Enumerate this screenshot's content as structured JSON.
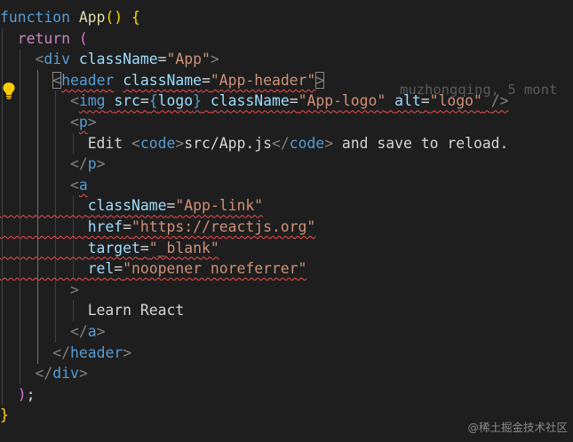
{
  "colors": {
    "background": "#1e1e1e",
    "keyword": "#569cd6",
    "control": "#c586c0",
    "function": "#dcdcaa",
    "paren_l1": "#ffd700",
    "paren_l2": "#da70d6",
    "tag": "#569cd6",
    "angle": "#808080",
    "attr": "#9cdcfe",
    "string": "#ce9178",
    "text": "#d4d4d4",
    "error": "#f14c4c",
    "lightbulb": "#ffcc00"
  },
  "lines": [
    [
      {
        "t": "function ",
        "c": "keyword"
      },
      {
        "t": "App",
        "c": "function"
      },
      {
        "t": "() {",
        "c": "paren_l1"
      }
    ],
    [
      {
        "t": "  "
      },
      {
        "t": "return",
        "c": "control"
      },
      {
        "t": " "
      },
      {
        "t": "(",
        "c": "paren_l2"
      }
    ],
    [
      {
        "t": "    "
      },
      {
        "t": "<",
        "c": "angle"
      },
      {
        "t": "div",
        "c": "tag"
      },
      {
        "t": " "
      },
      {
        "t": "className",
        "c": "attr"
      },
      {
        "t": "=",
        "c": "text"
      },
      {
        "t": "\"App\"",
        "c": "string"
      },
      {
        "t": ">",
        "c": "angle"
      }
    ],
    [
      {
        "t": "      "
      },
      {
        "t": "<",
        "c": "angle",
        "box": true
      },
      {
        "t": "header",
        "c": "tag",
        "sq": true
      },
      {
        "t": " "
      },
      {
        "t": "className",
        "c": "attr",
        "sq": true
      },
      {
        "t": "=",
        "c": "text",
        "sq": true
      },
      {
        "t": "\"App-header\"",
        "c": "string",
        "sq": true
      },
      {
        "t": ">",
        "c": "angle",
        "box": true
      }
    ],
    [
      {
        "t": "        "
      },
      {
        "t": "<",
        "c": "angle"
      },
      {
        "t": "img",
        "c": "tag",
        "sq": true
      },
      {
        "t": " ",
        "sq": true
      },
      {
        "t": "src",
        "c": "attr",
        "sq": true
      },
      {
        "t": "=",
        "c": "text",
        "sq": true
      },
      {
        "t": "{",
        "c": "keyword",
        "sq": true
      },
      {
        "t": "logo",
        "c": "attr",
        "sq": true
      },
      {
        "t": "}",
        "c": "keyword",
        "sq": true
      },
      {
        "t": " ",
        "sq": true
      },
      {
        "t": "className",
        "c": "attr",
        "sq": true
      },
      {
        "t": "=",
        "c": "text",
        "sq": true
      },
      {
        "t": "\"App-logo\"",
        "c": "string",
        "sq": true
      },
      {
        "t": " ",
        "sq": true
      },
      {
        "t": "alt",
        "c": "attr",
        "sq": true
      },
      {
        "t": "=",
        "c": "text",
        "sq": true
      },
      {
        "t": "\"logo\"",
        "c": "string",
        "sq": true
      },
      {
        "t": " ",
        "sq": true
      },
      {
        "t": "/>",
        "c": "angle",
        "sq": true
      }
    ],
    [
      {
        "t": "        "
      },
      {
        "t": "<",
        "c": "angle"
      },
      {
        "t": "p",
        "c": "tag",
        "sq": true
      },
      {
        "t": ">",
        "c": "angle"
      }
    ],
    [
      {
        "t": "          "
      },
      {
        "t": "Edit ",
        "c": "text"
      },
      {
        "t": "<",
        "c": "angle"
      },
      {
        "t": "code",
        "c": "tag"
      },
      {
        "t": ">",
        "c": "angle"
      },
      {
        "t": "src/App.js",
        "c": "text"
      },
      {
        "t": "</",
        "c": "angle"
      },
      {
        "t": "code",
        "c": "tag"
      },
      {
        "t": ">",
        "c": "angle"
      },
      {
        "t": " and save to reload.",
        "c": "text"
      }
    ],
    [
      {
        "t": "        "
      },
      {
        "t": "</",
        "c": "angle"
      },
      {
        "t": "p",
        "c": "tag"
      },
      {
        "t": ">",
        "c": "angle"
      }
    ],
    [
      {
        "t": "        "
      },
      {
        "t": "<",
        "c": "angle"
      },
      {
        "t": "a",
        "c": "tag",
        "sq": true
      }
    ],
    [
      {
        "t": "          ",
        "sq": true
      },
      {
        "t": "className",
        "c": "attr",
        "sq": true
      },
      {
        "t": "=",
        "c": "text",
        "sq": true
      },
      {
        "t": "\"App-link\"",
        "c": "string",
        "sq": true
      }
    ],
    [
      {
        "t": "          ",
        "sq": true
      },
      {
        "t": "href",
        "c": "attr",
        "sq": true
      },
      {
        "t": "=",
        "c": "text",
        "sq": true
      },
      {
        "t": "\"https://reactjs.org\"",
        "c": "string",
        "sq": true
      }
    ],
    [
      {
        "t": "          ",
        "sq": true
      },
      {
        "t": "target",
        "c": "attr",
        "sq": true
      },
      {
        "t": "=",
        "c": "text",
        "sq": true
      },
      {
        "t": "\"_blank\"",
        "c": "string",
        "sq": true
      }
    ],
    [
      {
        "t": "          ",
        "sq": true
      },
      {
        "t": "rel",
        "c": "attr",
        "sq": true
      },
      {
        "t": "=",
        "c": "text",
        "sq": true
      },
      {
        "t": "\"noopener noreferrer\"",
        "c": "string",
        "sq": true
      }
    ],
    [
      {
        "t": "        "
      },
      {
        "t": ">",
        "c": "angle"
      }
    ],
    [
      {
        "t": "          "
      },
      {
        "t": "Learn React",
        "c": "text"
      }
    ],
    [
      {
        "t": "        "
      },
      {
        "t": "</",
        "c": "angle"
      },
      {
        "t": "a",
        "c": "tag"
      },
      {
        "t": ">",
        "c": "angle"
      }
    ],
    [
      {
        "t": "      "
      },
      {
        "t": "</",
        "c": "angle"
      },
      {
        "t": "header",
        "c": "tag"
      },
      {
        "t": ">",
        "c": "angle"
      }
    ],
    [
      {
        "t": "    "
      },
      {
        "t": "</",
        "c": "angle"
      },
      {
        "t": "div",
        "c": "tag"
      },
      {
        "t": ">",
        "c": "angle"
      }
    ],
    [
      {
        "t": "  "
      },
      {
        "t": ")",
        "c": "paren_l2"
      },
      {
        "t": ";",
        "c": "text"
      }
    ],
    [
      {
        "t": "}",
        "c": "paren_l1"
      }
    ]
  ],
  "blame": "muzhongqing, 5 mont",
  "watermark": "@稀土掘金技术社区",
  "icons": {
    "lightbulb": "lightbulb-icon"
  }
}
